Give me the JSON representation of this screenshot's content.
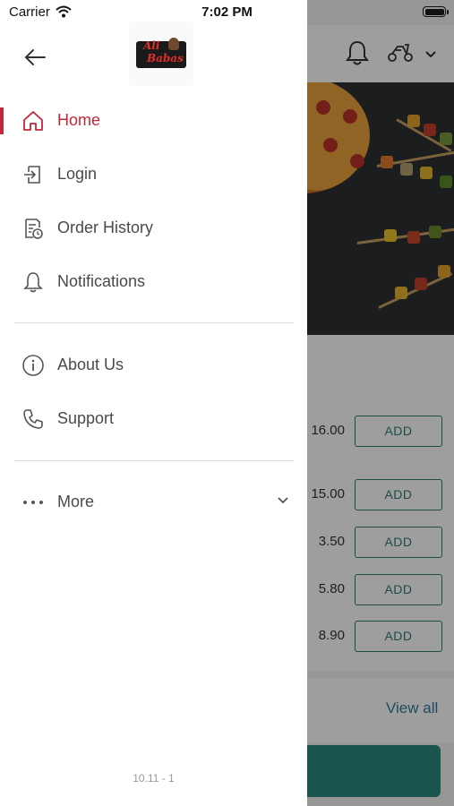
{
  "status_bar": {
    "carrier": "Carrier",
    "time": "7:02 PM"
  },
  "brand": {
    "logo_line1": "Ali",
    "logo_line2": "Babas"
  },
  "drawer": {
    "items": [
      {
        "label": "Home",
        "icon": "home-icon",
        "active": true
      },
      {
        "label": "Login",
        "icon": "login-icon"
      },
      {
        "label": "Order History",
        "icon": "receipt-icon"
      },
      {
        "label": "Notifications",
        "icon": "bell-icon"
      },
      {
        "label": "About Us",
        "icon": "info-icon"
      },
      {
        "label": "Support",
        "icon": "phone-icon"
      },
      {
        "label": "More",
        "icon": "more-icon"
      }
    ],
    "version": "10.11 - 1"
  },
  "background": {
    "products": [
      {
        "price": "16.00",
        "button": "ADD"
      },
      {
        "price": "15.00",
        "button": "ADD"
      },
      {
        "price": "3.50",
        "button": "ADD"
      },
      {
        "price": "5.80",
        "button": "ADD"
      },
      {
        "price": "8.90",
        "button": "ADD"
      }
    ],
    "view_all": "View all"
  },
  "colors": {
    "accent": "#c0283c",
    "teal": "#2e7d72",
    "link": "#2e7d9a"
  }
}
